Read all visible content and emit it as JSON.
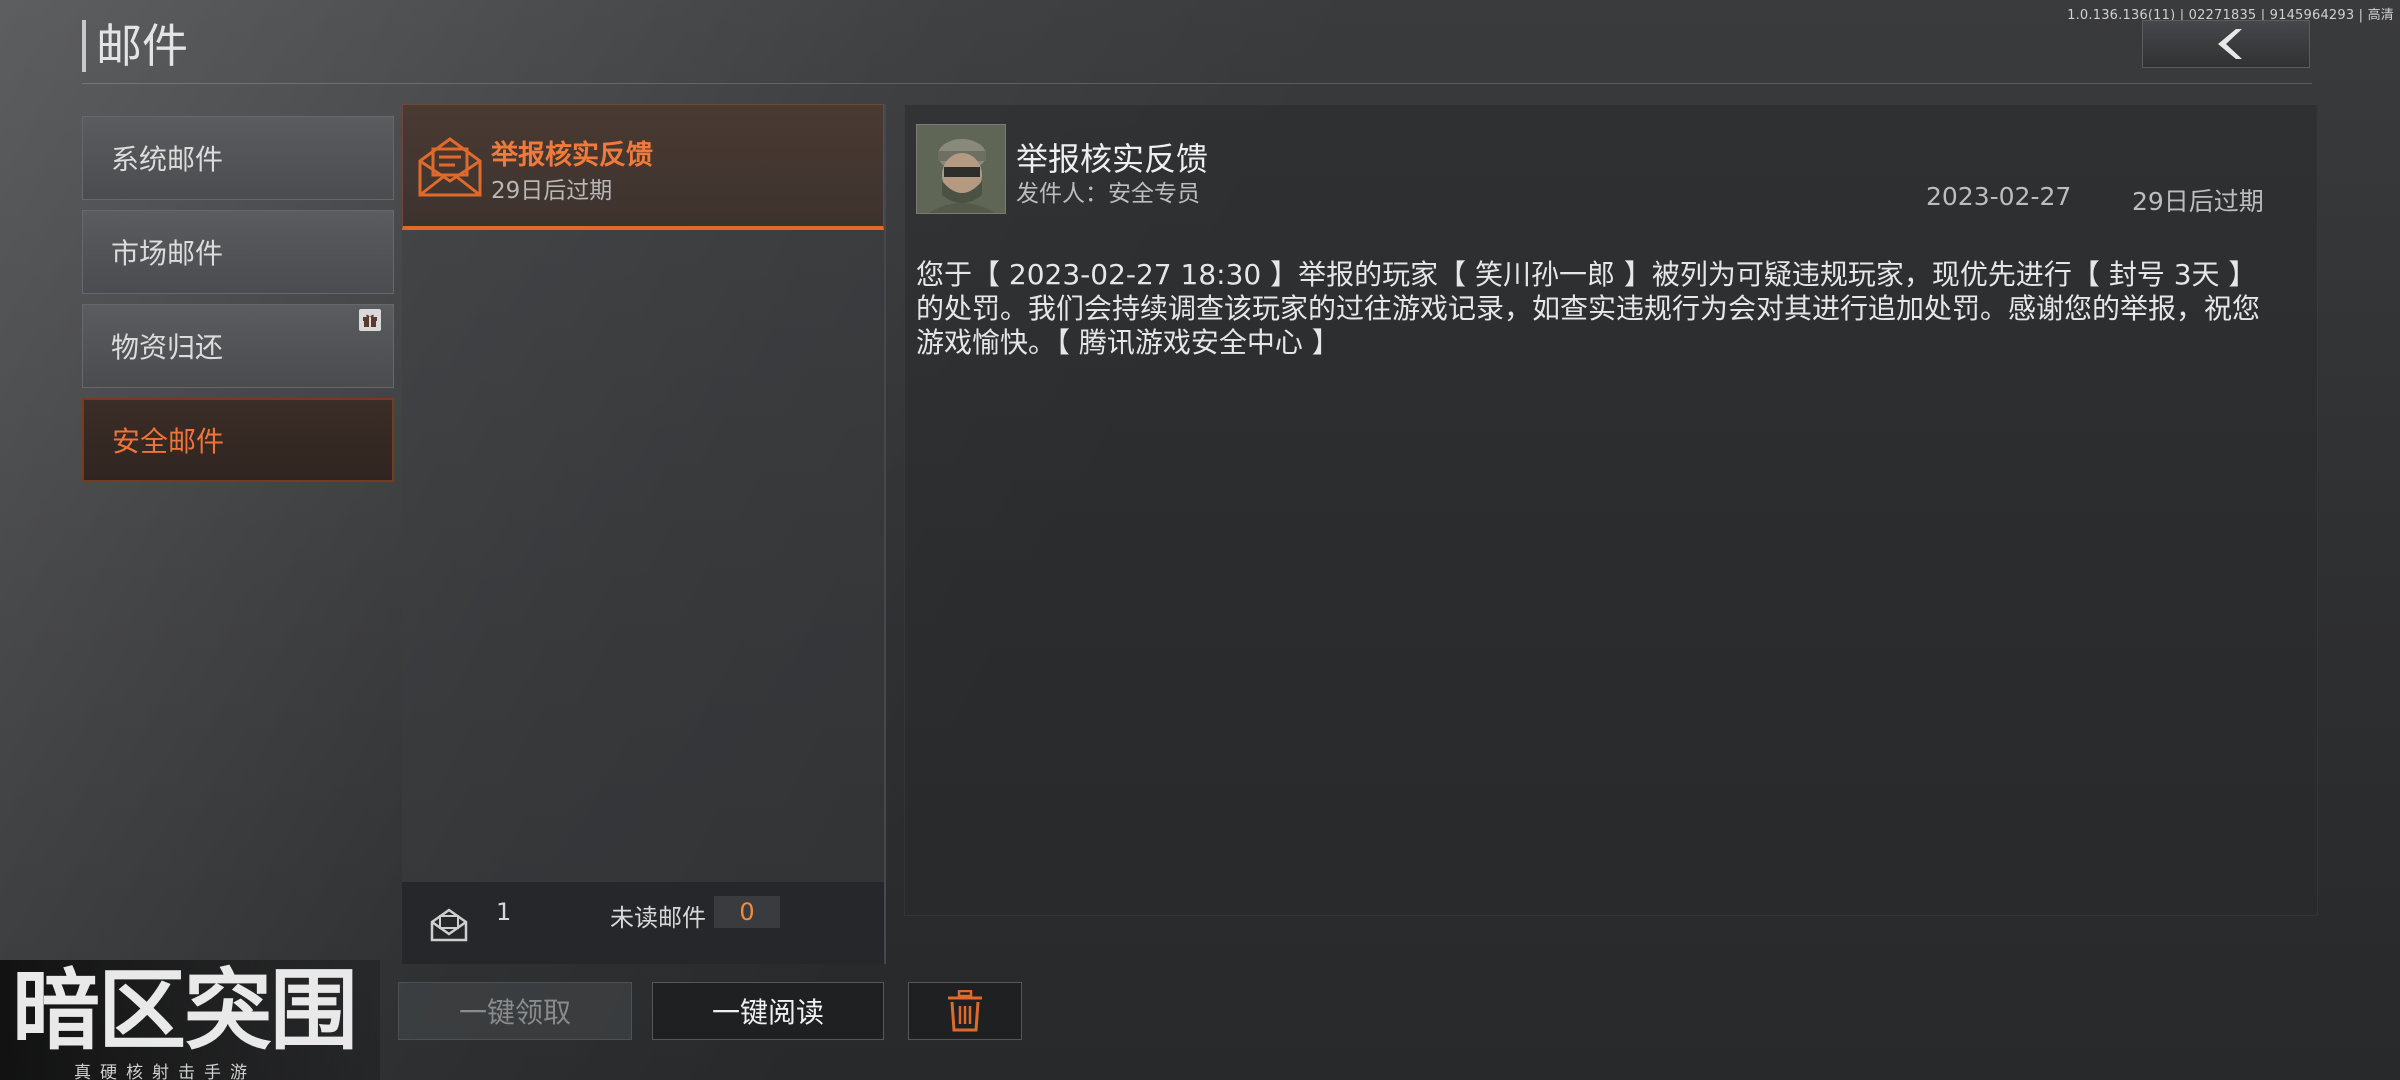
{
  "version_info": "1.0.136.136(11) | 02271835 | 9145964293 | 高清",
  "header": {
    "title": "邮件"
  },
  "categories": [
    {
      "label": "系统邮件",
      "active": false
    },
    {
      "label": "市场邮件",
      "active": false
    },
    {
      "label": "物资归还",
      "active": false,
      "badge": "gift-icon"
    },
    {
      "label": "安全邮件",
      "active": true
    }
  ],
  "mail_list": {
    "items": [
      {
        "title": "举报核实反馈",
        "expire": "29日后过期",
        "selected": true
      }
    ],
    "footer": {
      "count": "1",
      "unread_label": "未读邮件",
      "unread_value": "0"
    }
  },
  "mail_detail": {
    "subject": "举报核实反馈",
    "sender": "发件人：安全专员",
    "date": "2023-02-27",
    "expire": "29日后过期",
    "body": "您于【 2023-02-27 18:30 】举报的玩家【 笑川孙一郎 】被列为可疑违规玩家，现优先进行【 封号 3天 】的处罚。我们会持续调查该玩家的过往游戏记录，如查实违规行为会对其进行追加处罚。感谢您的举报，祝您游戏愉快。【 腾讯游戏安全中心 】"
  },
  "actions": {
    "claim_all": "一键领取",
    "read_all": "一键阅读"
  },
  "logo": {
    "main": "暗区突围",
    "sub": "真硬核射击手游"
  },
  "colors": {
    "accent": "#e06a2c",
    "accent_text": "#f0743a",
    "unread_value": "#f08c3c",
    "background": "#2b2c2e"
  }
}
